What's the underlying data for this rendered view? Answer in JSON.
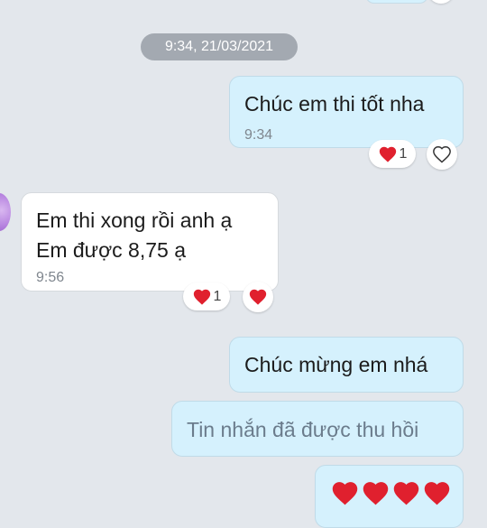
{
  "chat": {
    "date_separator": "9:34, 21/03/2021",
    "messages": [
      {
        "direction": "out",
        "text": "Chúc em thi tốt nha",
        "time": "9:34",
        "reactions": {
          "emoji": "heart",
          "count": "1"
        },
        "react_button_icon": "heart-outline-icon"
      },
      {
        "direction": "in",
        "text": "Em thi xong rồi anh ạ\nEm được 8,75 ạ",
        "time": "9:56",
        "reactions": {
          "emoji": "heart",
          "count": "1"
        },
        "react_button_icon": "heart-filled-icon"
      },
      {
        "direction": "out",
        "text": "Chúc mừng em nhá"
      },
      {
        "direction": "out",
        "text": "Tin nhắn đã được thu hồi",
        "recalled": true
      },
      {
        "direction": "out",
        "text": "",
        "emoji_hearts": 4
      }
    ]
  },
  "colors": {
    "background": "#e3e7ec",
    "outgoing_bubble": "#d5f1fd",
    "incoming_bubble": "#ffffff",
    "date_pill": "#a3a9b1",
    "heart": "#e0202e"
  }
}
